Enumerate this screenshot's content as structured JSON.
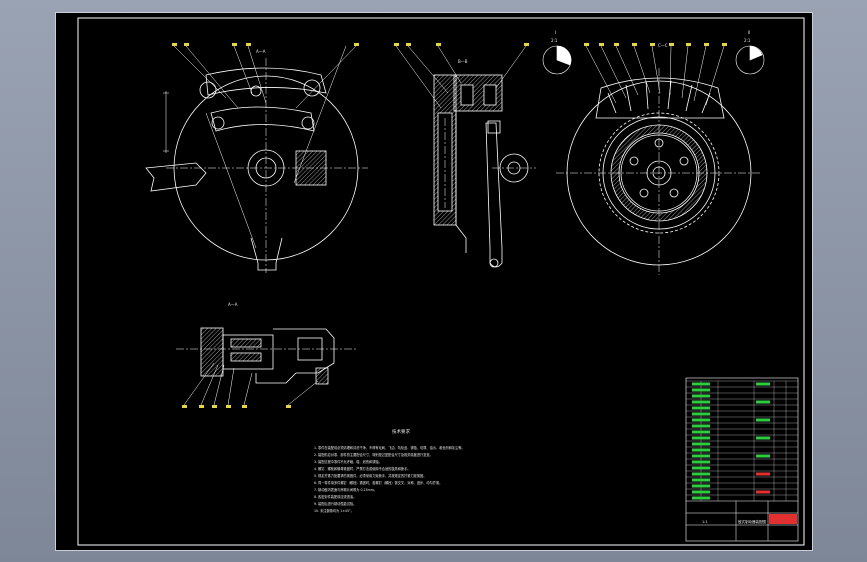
{
  "canvas": {
    "background": "#000000",
    "frame_color": "#ffffff"
  },
  "colors": {
    "line": "#ffffff",
    "leader": "#ffffff",
    "label": "#e6d44a",
    "hatch": "#ffffff",
    "title_green": "#2ecc40",
    "title_red": "#e23030",
    "sheet_bg": "#8d95a6"
  },
  "views": {
    "front_section_label": "A—A",
    "side_view_label": "B—B",
    "bottom_section_label": "A—A",
    "right_view_label": "C—C"
  },
  "details": {
    "detail_1_label": "I",
    "detail_1_scale": "2:1",
    "detail_2_label": "II",
    "detail_2_scale": "2:1"
  },
  "notes": {
    "heading": "技术要求",
    "lines": [
      "1. 零件在装配前必须清理和清洗干净，不得有毛刺、飞边、氧化皮、锈蚀、切屑、油污、着色剂和灰尘等。",
      "2. 装配前应对零、部件的主要配合尺寸，特别是过盈配合尺寸及相关精度进行复查。",
      "3. 装配过程中零件不允许磕、碰、划伤和锈蚀。",
      "4. 螺钉、螺栓和螺母紧固时，严禁打击或使用不合适的旋具和扳手。",
      "5. 规定拧紧力矩要求的紧固件，必须采用力矩扳手，并按规定的拧紧力矩紧固。",
      "6. 同一零件用多件螺钉（螺栓）紧固时，各螺钉（螺栓）需交叉、对称、逐步、均匀拧紧。",
      "7. 制动鼓内表面与摩擦片间隙为 0.25mm。",
      "8. 各密封件装配前应浸透油。",
      "9. 装配后进行制动性能试验。",
      "10. 未注倒角均为 1×45°。"
    ]
  },
  "title_block": {
    "drawing_title": "鼓式制动器装配图",
    "company": "",
    "scale": "1:1"
  }
}
